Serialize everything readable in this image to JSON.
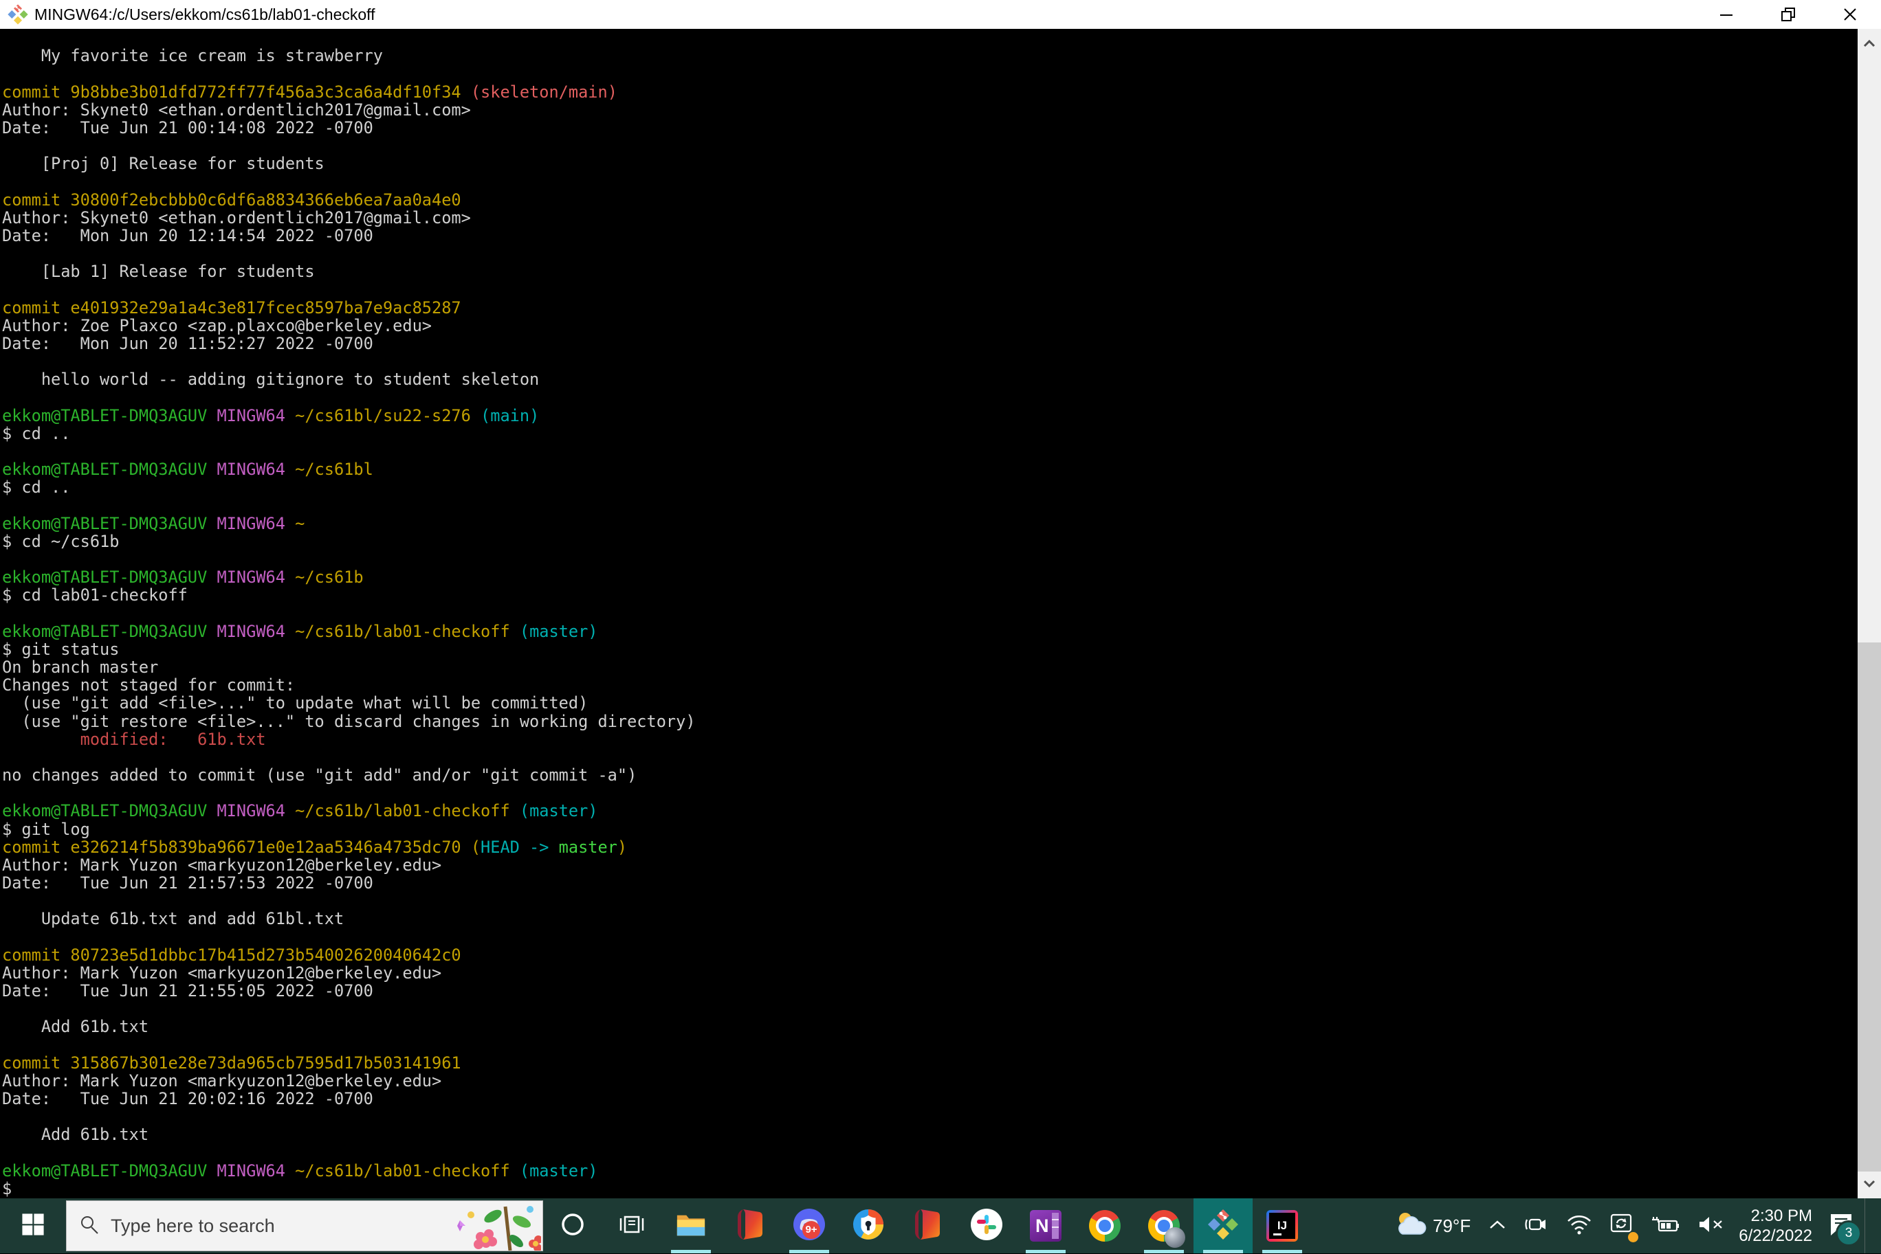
{
  "window": {
    "title": "MINGW64:/c/Users/ekkom/cs61b/lab01-checkoff",
    "controls": [
      "minimize",
      "restore",
      "close"
    ]
  },
  "colors": {
    "terminal_bg": "#000000",
    "terminal_fg": "#d0d0d0",
    "git_green": "#2cb42c",
    "git_bright_green": "#42d442",
    "git_yellow": "#c2a000",
    "git_magenta": "#c35fc3",
    "git_cyan": "#00b0b0",
    "git_remote_red": "#e25f5f",
    "git_status_red": "#cc4b4b",
    "taskbar_bg": "#1d3a34",
    "taskbar_active_tile": "#0e706c",
    "running_underline": "#9fe8ec",
    "scrollbar_track": "#f0f0f0",
    "scrollbar_thumb": "#cdcdcd"
  },
  "terminal": {
    "lines": [
      [],
      [
        [
          "fg",
          "    My favorite ice cream is strawberry"
        ]
      ],
      [],
      [
        [
          "yellow",
          "commit 9b8bbe3b01dfd772ff77f456a3c3ca6a4df10f34 "
        ],
        [
          "salmon",
          "(skeleton/main)"
        ]
      ],
      [
        [
          "fg",
          "Author: Skynet0 <ethan.ordentlich2017@gmail.com>"
        ]
      ],
      [
        [
          "fg",
          "Date:   Tue Jun 21 00:14:08 2022 -0700"
        ]
      ],
      [],
      [
        [
          "fg",
          "    [Proj 0] Release for students"
        ]
      ],
      [],
      [
        [
          "yellow",
          "commit 30800f2ebcbbb0c6df6a8834366eb6ea7aa0a4e0"
        ]
      ],
      [
        [
          "fg",
          "Author: Skynet0 <ethan.ordentlich2017@gmail.com>"
        ]
      ],
      [
        [
          "fg",
          "Date:   Mon Jun 20 12:14:54 2022 -0700"
        ]
      ],
      [],
      [
        [
          "fg",
          "    [Lab 1] Release for students"
        ]
      ],
      [],
      [
        [
          "yellow",
          "commit e401932e29a1a4c3e817fcec8597ba7e9ac85287"
        ]
      ],
      [
        [
          "fg",
          "Author: Zoe Plaxco <zap.plaxco@berkeley.edu>"
        ]
      ],
      [
        [
          "fg",
          "Date:   Mon Jun 20 11:52:27 2022 -0700"
        ]
      ],
      [],
      [
        [
          "fg",
          "    hello world -- adding gitignore to student skeleton"
        ]
      ],
      [],
      [
        [
          "green",
          "ekkom@TABLET-DMQ3AGUV "
        ],
        [
          "magenta",
          "MINGW64 "
        ],
        [
          "yellow",
          "~/cs61bl/su22-s276 "
        ],
        [
          "cyan",
          "(main)"
        ]
      ],
      [
        [
          "fg",
          "$ cd .."
        ]
      ],
      [],
      [
        [
          "green",
          "ekkom@TABLET-DMQ3AGUV "
        ],
        [
          "magenta",
          "MINGW64 "
        ],
        [
          "yellow",
          "~/cs61bl"
        ]
      ],
      [
        [
          "fg",
          "$ cd .."
        ]
      ],
      [],
      [
        [
          "green",
          "ekkom@TABLET-DMQ3AGUV "
        ],
        [
          "magenta",
          "MINGW64 "
        ],
        [
          "yellow",
          "~"
        ]
      ],
      [
        [
          "fg",
          "$ cd ~/cs61b"
        ]
      ],
      [],
      [
        [
          "green",
          "ekkom@TABLET-DMQ3AGUV "
        ],
        [
          "magenta",
          "MINGW64 "
        ],
        [
          "yellow",
          "~/cs61b"
        ]
      ],
      [
        [
          "fg",
          "$ cd lab01-checkoff"
        ]
      ],
      [],
      [
        [
          "green",
          "ekkom@TABLET-DMQ3AGUV "
        ],
        [
          "magenta",
          "MINGW64 "
        ],
        [
          "yellow",
          "~/cs61b/lab01-checkoff "
        ],
        [
          "cyan",
          "(master)"
        ]
      ],
      [
        [
          "fg",
          "$ git status"
        ]
      ],
      [
        [
          "fg",
          "On branch master"
        ]
      ],
      [
        [
          "fg",
          "Changes not staged for commit:"
        ]
      ],
      [
        [
          "fg",
          "  (use \"git add <file>...\" to update what will be committed)"
        ]
      ],
      [
        [
          "fg",
          "  (use \"git restore <file>...\" to discard changes in working directory)"
        ]
      ],
      [
        [
          "red",
          "        modified:   61b.txt"
        ]
      ],
      [],
      [
        [
          "fg",
          "no changes added to commit (use \"git add\" and/or \"git commit -a\")"
        ]
      ],
      [],
      [
        [
          "green",
          "ekkom@TABLET-DMQ3AGUV "
        ],
        [
          "magenta",
          "MINGW64 "
        ],
        [
          "yellow",
          "~/cs61b/lab01-checkoff "
        ],
        [
          "cyan",
          "(master)"
        ]
      ],
      [
        [
          "fg",
          "$ git log"
        ]
      ],
      [
        [
          "yellow",
          "commit e326214f5b839ba96671e0e12aa5346a4735dc70 ("
        ],
        [
          "cyan",
          "HEAD -> "
        ],
        [
          "bgreen",
          "master"
        ],
        [
          "yellow",
          ")"
        ]
      ],
      [
        [
          "fg",
          "Author: Mark Yuzon <markyuzon12@berkeley.edu>"
        ]
      ],
      [
        [
          "fg",
          "Date:   Tue Jun 21 21:57:53 2022 -0700"
        ]
      ],
      [],
      [
        [
          "fg",
          "    Update 61b.txt and add 61bl.txt"
        ]
      ],
      [],
      [
        [
          "yellow",
          "commit 80723e5d1dbbc17b415d273b54002620040642c0"
        ]
      ],
      [
        [
          "fg",
          "Author: Mark Yuzon <markyuzon12@berkeley.edu>"
        ]
      ],
      [
        [
          "fg",
          "Date:   Tue Jun 21 21:55:05 2022 -0700"
        ]
      ],
      [],
      [
        [
          "fg",
          "    Add 61b.txt"
        ]
      ],
      [],
      [
        [
          "yellow",
          "commit 315867b301e28e73da965cb7595d17b503141961"
        ]
      ],
      [
        [
          "fg",
          "Author: Mark Yuzon <markyuzon12@berkeley.edu>"
        ]
      ],
      [
        [
          "fg",
          "Date:   Tue Jun 21 20:02:16 2022 -0700"
        ]
      ],
      [],
      [
        [
          "fg",
          "    Add 61b.txt"
        ]
      ],
      [],
      [
        [
          "green",
          "ekkom@TABLET-DMQ3AGUV "
        ],
        [
          "magenta",
          "MINGW64 "
        ],
        [
          "yellow",
          "~/cs61b/lab01-checkoff "
        ],
        [
          "cyan",
          "(master)"
        ]
      ],
      [
        [
          "fg",
          "$"
        ]
      ]
    ]
  },
  "taskbar": {
    "search_placeholder": "Type here to search",
    "discord_badge": "9+",
    "items": [
      {
        "name": "start",
        "running": false,
        "active": false
      },
      {
        "name": "search",
        "running": false,
        "active": false
      },
      {
        "name": "cortana",
        "running": false,
        "active": false
      },
      {
        "name": "task-view",
        "running": false,
        "active": false
      },
      {
        "name": "file-explorer",
        "running": true,
        "active": false
      },
      {
        "name": "office",
        "running": false,
        "active": false
      },
      {
        "name": "discord",
        "running": true,
        "active": false
      },
      {
        "name": "privacy-shield",
        "running": false,
        "active": false
      },
      {
        "name": "office-2",
        "running": false,
        "active": false
      },
      {
        "name": "slack",
        "running": false,
        "active": false
      },
      {
        "name": "onenote",
        "running": true,
        "active": false
      },
      {
        "name": "chrome",
        "running": false,
        "active": false
      },
      {
        "name": "chrome-profile",
        "running": true,
        "active": false
      },
      {
        "name": "git-bash",
        "running": true,
        "active": true
      },
      {
        "name": "intellij",
        "running": true,
        "active": false
      }
    ]
  },
  "tray": {
    "temperature": "79°F",
    "time": "2:30 PM",
    "date": "6/22/2022",
    "notification_count": "3",
    "icons": [
      "weather-icon",
      "chevron-up-icon",
      "meet-now-icon",
      "wifi-icon",
      "sync-icon",
      "battery-charging-icon",
      "volume-muted-icon",
      "clock",
      "action-center-icon"
    ]
  }
}
